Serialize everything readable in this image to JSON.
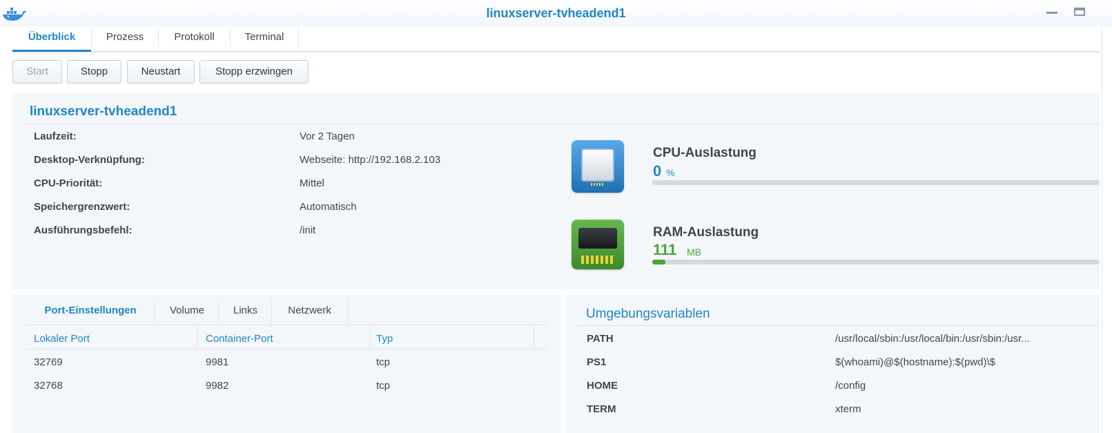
{
  "window": {
    "title": "linuxserver-tvheadend1",
    "app_icon": "docker-whale-icon"
  },
  "tabs": [
    {
      "label": "Überblick",
      "active": true
    },
    {
      "label": "Prozess",
      "active": false
    },
    {
      "label": "Protokoll",
      "active": false
    },
    {
      "label": "Terminal",
      "active": false
    }
  ],
  "toolbar": {
    "start_label": "Start",
    "start_disabled": true,
    "stop_label": "Stopp",
    "restart_label": "Neustart",
    "force_stop_label": "Stopp erzwingen"
  },
  "overview": {
    "title": "linuxserver-tvheadend1",
    "rows": [
      {
        "label": "Laufzeit:",
        "value": "Vor 2 Tagen"
      },
      {
        "label": "Desktop-Verknüpfung:",
        "value": "Webseite: http://192.168.2.103"
      },
      {
        "label": "CPU-Priorität:",
        "value": "Mittel"
      },
      {
        "label": "Speichergrenzwert:",
        "value": "Automatisch"
      },
      {
        "label": "Ausführungsbefehl:",
        "value": "/init"
      }
    ],
    "cpu": {
      "title": "CPU-Auslastung",
      "value": "0",
      "unit": "%",
      "fraction": 0.0,
      "color": "#1f86c8",
      "icon": "cpu-chip-icon"
    },
    "ram": {
      "title": "RAM-Auslastung",
      "value": "111",
      "unit": "MB",
      "fraction": 0.03,
      "color": "#4aa63a",
      "icon": "ram-module-icon"
    }
  },
  "ports": {
    "tabs": [
      {
        "label": "Port-Einstellungen",
        "active": true
      },
      {
        "label": "Volume",
        "active": false
      },
      {
        "label": "Links",
        "active": false
      },
      {
        "label": "Netzwerk",
        "active": false
      }
    ],
    "columns": [
      "Lokaler Port",
      "Container-Port",
      "Typ"
    ],
    "rows": [
      [
        "32769",
        "9981",
        "tcp"
      ],
      [
        "32768",
        "9982",
        "tcp"
      ]
    ]
  },
  "env": {
    "title": "Umgebungsvariablen",
    "rows": [
      {
        "key": "PATH",
        "value": "/usr/local/sbin:/usr/local/bin:/usr/sbin:/usr..."
      },
      {
        "key": "PS1",
        "value": "$(whoami)@$(hostname):$(pwd)\\$"
      },
      {
        "key": "HOME",
        "value": "/config"
      },
      {
        "key": "TERM",
        "value": "xterm"
      }
    ]
  },
  "colors": {
    "accent": "#1f86c8",
    "ram_green": "#4aa63a",
    "panel_bg": "#f4f7fa"
  }
}
